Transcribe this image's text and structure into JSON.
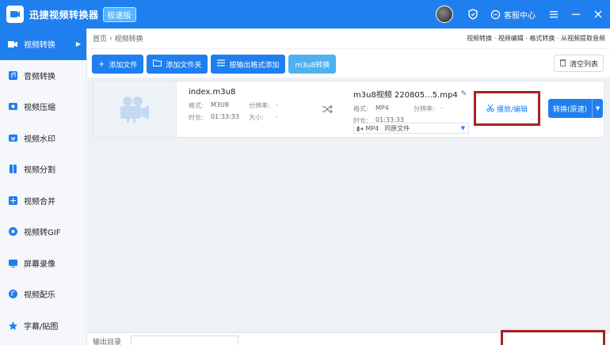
{
  "app": {
    "title": "迅捷视频转换器",
    "version_badge": "极速版",
    "service_label": "客服中心",
    "accent": "#1f7fef",
    "highlight_color": "#a52324"
  },
  "sidebar": {
    "items": [
      {
        "label": "视频转换",
        "icon": "video-convert-icon",
        "active": true
      },
      {
        "label": "音频转换",
        "icon": "audio-convert-icon"
      },
      {
        "label": "视频压缩",
        "icon": "compress-icon"
      },
      {
        "label": "视频水印",
        "icon": "watermark-icon"
      },
      {
        "label": "视频分割",
        "icon": "split-icon"
      },
      {
        "label": "视频合并",
        "icon": "merge-icon"
      },
      {
        "label": "视频转GIF",
        "icon": "gif-icon"
      },
      {
        "label": "屏幕录像",
        "icon": "screen-record-icon"
      },
      {
        "label": "视频配乐",
        "icon": "music-icon"
      },
      {
        "label": "字幕/贴图",
        "icon": "subtitle-icon"
      }
    ]
  },
  "breadcrumb": {
    "home": "首页",
    "current": "视频转换",
    "links": "视频转换 · 视频编辑 · 格式转换 · 从视频提取音频"
  },
  "toolbar": {
    "add_file": "添加文件",
    "add_folder": "添加文件夹",
    "add_by_format": "按输出格式添加",
    "m3u8": "m3u8转换",
    "clear": "清空列表"
  },
  "file": {
    "source_name": "index.m3u8",
    "format_label": "格式:",
    "format_value": "M3U8",
    "resolution_label": "分辨率:",
    "resolution_value": "-",
    "duration_label": "时长:",
    "duration_value": "01:33:33",
    "size_label": "大小:",
    "size_value": "-",
    "dest_name": "m3u8视频 220805...5.mp4",
    "dest_format_value": "MP4",
    "dest_resolution_value": "-",
    "dest_duration_value": "01:33:33",
    "output_format": "MP4",
    "output_quality": "同原文件",
    "edit_label": "播放/编辑",
    "convert_label": "转换(原速)"
  },
  "bottom": {
    "output_label": "输出目录"
  }
}
